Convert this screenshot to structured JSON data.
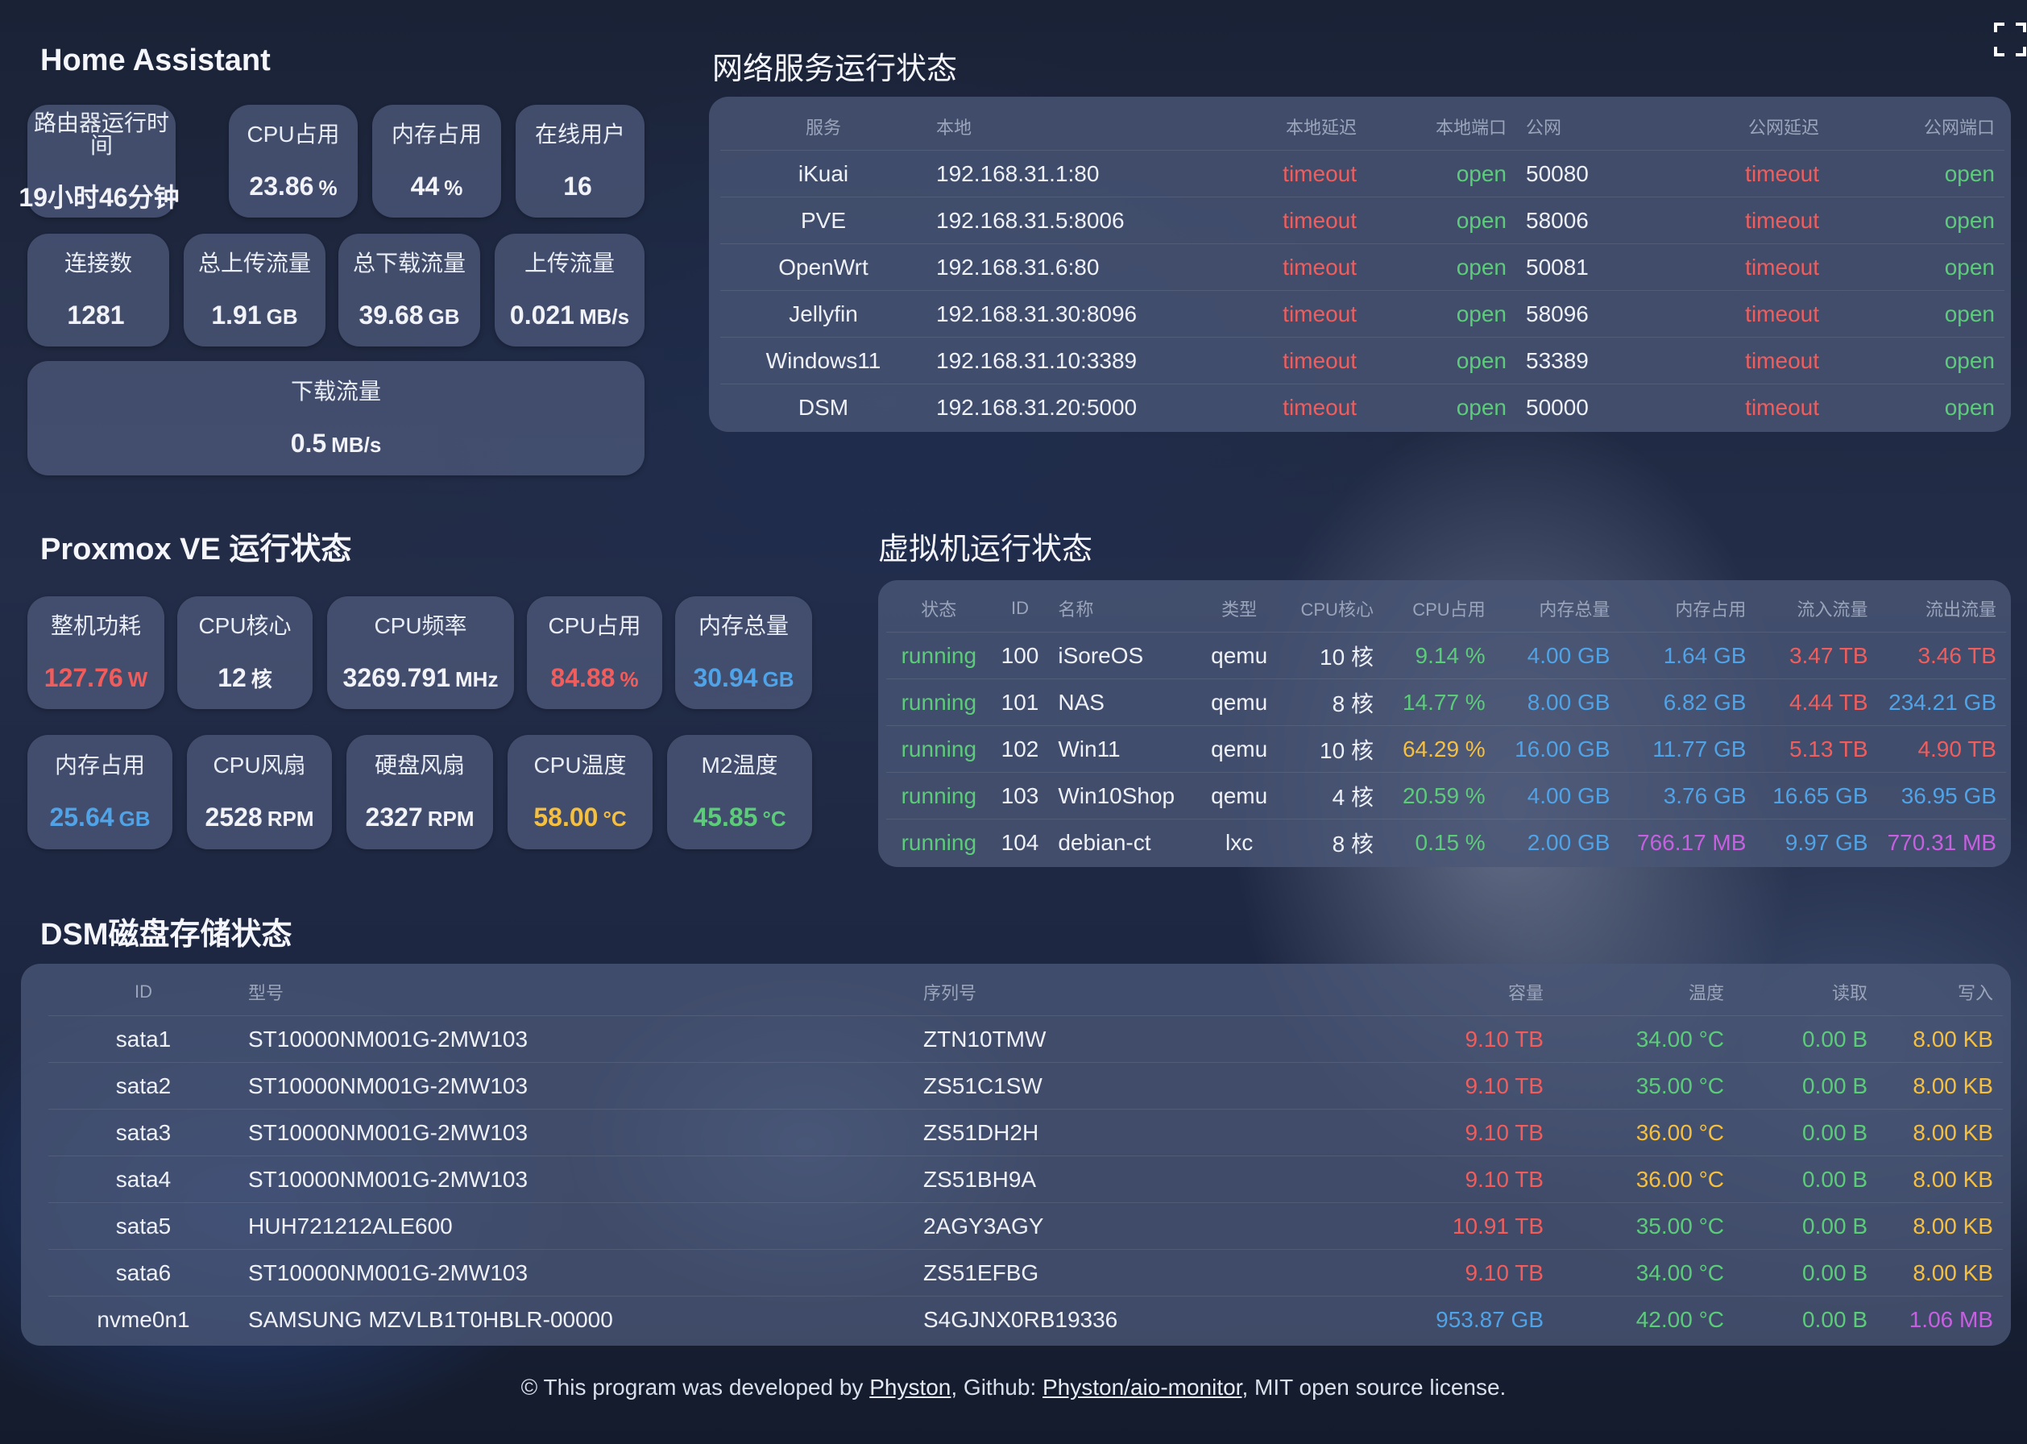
{
  "ha": {
    "title": "Home Assistant",
    "cards": [
      {
        "label": "路由器运行时间",
        "value": "19小时46分钟",
        "unit": ""
      },
      {
        "label": "CPU占用",
        "value": "23.86",
        "unit": "%"
      },
      {
        "label": "内存占用",
        "value": "44",
        "unit": "%"
      },
      {
        "label": "在线用户",
        "value": "16",
        "unit": ""
      },
      {
        "label": "连接数",
        "value": "1281",
        "unit": ""
      },
      {
        "label": "总上传流量",
        "value": "1.91",
        "unit": "GB"
      },
      {
        "label": "总下载流量",
        "value": "39.68",
        "unit": "GB"
      },
      {
        "label": "上传流量",
        "value": "0.021",
        "unit": "MB/s"
      },
      {
        "label": "下载流量",
        "value": "0.5",
        "unit": "MB/s"
      }
    ]
  },
  "net": {
    "title": "网络服务运行状态",
    "headers": [
      "服务",
      "本地",
      "本地延迟",
      "本地端口",
      "公网",
      "公网延迟",
      "公网端口"
    ],
    "rows": [
      {
        "service": "iKuai",
        "local": "192.168.31.1:80",
        "local_latency": "timeout",
        "local_port": "open",
        "public": "50080",
        "public_latency": "timeout",
        "public_port": "open"
      },
      {
        "service": "PVE",
        "local": "192.168.31.5:8006",
        "local_latency": "timeout",
        "local_port": "open",
        "public": "58006",
        "public_latency": "timeout",
        "public_port": "open"
      },
      {
        "service": "OpenWrt",
        "local": "192.168.31.6:80",
        "local_latency": "timeout",
        "local_port": "open",
        "public": "50081",
        "public_latency": "timeout",
        "public_port": "open"
      },
      {
        "service": "Jellyfin",
        "local": "192.168.31.30:8096",
        "local_latency": "timeout",
        "local_port": "open",
        "public": "58096",
        "public_latency": "timeout",
        "public_port": "open"
      },
      {
        "service": "Windows11",
        "local": "192.168.31.10:3389",
        "local_latency": "timeout",
        "local_port": "open",
        "public": "53389",
        "public_latency": "timeout",
        "public_port": "open"
      },
      {
        "service": "DSM",
        "local": "192.168.31.20:5000",
        "local_latency": "timeout",
        "local_port": "open",
        "public": "50000",
        "public_latency": "timeout",
        "public_port": "open"
      }
    ]
  },
  "pve": {
    "title": "Proxmox VE 运行状态",
    "cards": [
      {
        "label": "整机功耗",
        "value": "127.76",
        "unit": "W",
        "color": "#f05d5d"
      },
      {
        "label": "CPU核心",
        "value": "12",
        "unit": "核",
        "color": ""
      },
      {
        "label": "CPU频率",
        "value": "3269.791",
        "unit": "MHz",
        "color": ""
      },
      {
        "label": "CPU占用",
        "value": "84.88",
        "unit": "%",
        "color": "#f05d5d"
      },
      {
        "label": "内存总量",
        "value": "30.94",
        "unit": "GB",
        "color": "#4fa3e6"
      },
      {
        "label": "内存占用",
        "value": "25.64",
        "unit": "GB",
        "color": "#4fa3e6"
      },
      {
        "label": "CPU风扇",
        "value": "2528",
        "unit": "RPM",
        "color": ""
      },
      {
        "label": "硬盘风扇",
        "value": "2327",
        "unit": "RPM",
        "color": ""
      },
      {
        "label": "CPU温度",
        "value": "58.00",
        "unit": "°C",
        "color": "#f5c042"
      },
      {
        "label": "M2温度",
        "value": "45.85",
        "unit": "°C",
        "color": "#5ccc7a"
      }
    ]
  },
  "vm": {
    "title": "虚拟机运行状态",
    "headers": [
      "状态",
      "ID",
      "名称",
      "类型",
      "CPU核心",
      "CPU占用",
      "内存总量",
      "内存占用",
      "流入流量",
      "流出流量"
    ],
    "rows": [
      {
        "status": "running",
        "id": "100",
        "name": "iSoreOS",
        "type": "qemu",
        "cores": "10 核",
        "cpu": "9.14 %",
        "mem_total": "4.00 GB",
        "mem_used": "1.64 GB",
        "net_in": "3.47 TB",
        "net_out": "3.46 TB"
      },
      {
        "status": "running",
        "id": "101",
        "name": "NAS",
        "type": "qemu",
        "cores": "8 核",
        "cpu": "14.77 %",
        "mem_total": "8.00 GB",
        "mem_used": "6.82 GB",
        "net_in": "4.44 TB",
        "net_out": "234.21 GB"
      },
      {
        "status": "running",
        "id": "102",
        "name": "Win11",
        "type": "qemu",
        "cores": "10 核",
        "cpu": "64.29 %",
        "mem_total": "16.00 GB",
        "mem_used": "11.77 GB",
        "net_in": "5.13 TB",
        "net_out": "4.90 TB"
      },
      {
        "status": "running",
        "id": "103",
        "name": "Win10Shop",
        "type": "qemu",
        "cores": "4 核",
        "cpu": "20.59 %",
        "mem_total": "4.00 GB",
        "mem_used": "3.76 GB",
        "net_in": "16.65 GB",
        "net_out": "36.95 GB"
      },
      {
        "status": "running",
        "id": "104",
        "name": "debian-ct",
        "type": "lxc",
        "cores": "8 核",
        "cpu": "0.15 %",
        "mem_total": "2.00 GB",
        "mem_used": "766.17 MB",
        "net_in": "9.97 GB",
        "net_out": "770.31 MB"
      }
    ],
    "colors": {
      "cpu": [
        "#5ccc7a",
        "#5ccc7a",
        "#f5c042",
        "#5ccc7a",
        "#5ccc7a"
      ],
      "mem_used": [
        "#4fa3e6",
        "#4fa3e6",
        "#4fa3e6",
        "#4fa3e6",
        "#c760e0"
      ],
      "net_in": [
        "#f05d5d",
        "#f05d5d",
        "#f05d5d",
        "#4fa3e6",
        "#4fa3e6"
      ],
      "net_out": [
        "#f05d5d",
        "#4fa3e6",
        "#f05d5d",
        "#4fa3e6",
        "#c760e0"
      ]
    }
  },
  "dsm": {
    "title": "DSM磁盘存储状态",
    "headers": [
      "ID",
      "型号",
      "序列号",
      "容量",
      "温度",
      "读取",
      "写入"
    ],
    "rows": [
      {
        "id": "sata1",
        "model": "ST10000NM001G-2MW103",
        "serial": "ZTN10TMW",
        "capacity": "9.10 TB",
        "temp": "34.00 °C",
        "read": "0.00 B",
        "write": "8.00 KB"
      },
      {
        "id": "sata2",
        "model": "ST10000NM001G-2MW103",
        "serial": "ZS51C1SW",
        "capacity": "9.10 TB",
        "temp": "35.00 °C",
        "read": "0.00 B",
        "write": "8.00 KB"
      },
      {
        "id": "sata3",
        "model": "ST10000NM001G-2MW103",
        "serial": "ZS51DH2H",
        "capacity": "9.10 TB",
        "temp": "36.00 °C",
        "read": "0.00 B",
        "write": "8.00 KB"
      },
      {
        "id": "sata4",
        "model": "ST10000NM001G-2MW103",
        "serial": "ZS51BH9A",
        "capacity": "9.10 TB",
        "temp": "36.00 °C",
        "read": "0.00 B",
        "write": "8.00 KB"
      },
      {
        "id": "sata5",
        "model": "HUH721212ALE600",
        "serial": "2AGY3AGY",
        "capacity": "10.91 TB",
        "temp": "35.00 °C",
        "read": "0.00 B",
        "write": "8.00 KB"
      },
      {
        "id": "sata6",
        "model": "ST10000NM001G-2MW103",
        "serial": "ZS51EFBG",
        "capacity": "9.10 TB",
        "temp": "34.00 °C",
        "read": "0.00 B",
        "write": "8.00 KB"
      },
      {
        "id": "nvme0n1",
        "model": "SAMSUNG MZVLB1T0HBLR-00000",
        "serial": "S4GJNX0RB19336",
        "capacity": "953.87 GB",
        "temp": "42.00 °C",
        "read": "0.00 B",
        "write": "1.06 MB"
      }
    ],
    "colors": {
      "capacity": [
        "#f05d5d",
        "#f05d5d",
        "#f05d5d",
        "#f05d5d",
        "#f05d5d",
        "#f05d5d",
        "#4fa3e6"
      ],
      "temp": [
        "#5ccc7a",
        "#5ccc7a",
        "#f5c042",
        "#f5c042",
        "#5ccc7a",
        "#5ccc7a",
        "#5ccc7a"
      ],
      "write": [
        "#f5c042",
        "#f5c042",
        "#f5c042",
        "#f5c042",
        "#f5c042",
        "#f5c042",
        "#c760e0"
      ]
    }
  },
  "footer": {
    "prefix": "© This program was developed by ",
    "author": "Physton",
    "middle": ", Github: ",
    "repo": "Physton/aio-monitor",
    "suffix": ", MIT open source license."
  },
  "icons": {
    "fullscreen": "fullscreen-icon"
  }
}
